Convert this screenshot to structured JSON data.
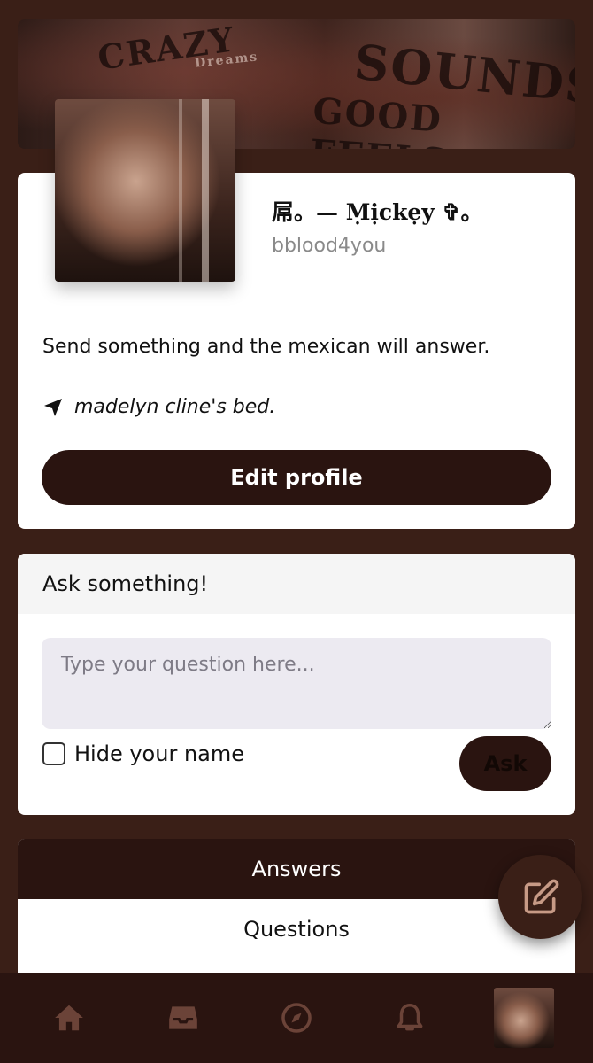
{
  "profile": {
    "display_name": "屌。— Ṃịckẹy ✞。",
    "username": "bblood4you",
    "bio": "Send something and the mexican will answer.",
    "location": "madelyn cline's bed.",
    "edit_label": "Edit profile"
  },
  "banner": {
    "graffiti": [
      "CRAZY",
      "SOUNDS",
      "GOOD FEELS GOOD",
      "Dreams"
    ]
  },
  "ask": {
    "header": "Ask something!",
    "placeholder": "Type your question here...",
    "hide_label": "Hide your name",
    "ask_label": "Ask"
  },
  "tabs": {
    "answers": "Answers",
    "questions": "Questions"
  },
  "nav": {
    "icons": [
      "home-icon",
      "inbox-icon",
      "compass-icon",
      "bell-icon",
      "profile-avatar"
    ]
  },
  "colors": {
    "background": "#3a1f17",
    "accent": "#2a1410",
    "card": "#ffffff"
  }
}
